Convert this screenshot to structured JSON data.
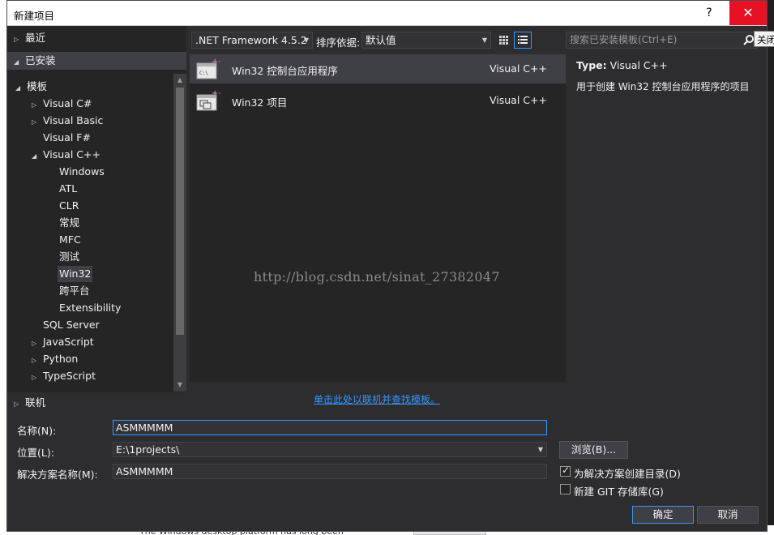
{
  "window": {
    "title": "新建项目",
    "help_label": "?",
    "close_label": "✕",
    "tooltip": "关闭"
  },
  "tree": {
    "recent": "最近",
    "installed": "已安装",
    "templates": "模板",
    "items": [
      {
        "label": "Visual C#"
      },
      {
        "label": "Visual Basic"
      },
      {
        "label": "Visual F#"
      },
      {
        "label": "Visual C++"
      },
      {
        "label": "Windows"
      },
      {
        "label": "ATL"
      },
      {
        "label": "CLR"
      },
      {
        "label": "常规"
      },
      {
        "label": "MFC"
      },
      {
        "label": "测试"
      },
      {
        "label": "Win32"
      },
      {
        "label": "跨平台"
      },
      {
        "label": "Extensibility"
      },
      {
        "label": "SQL Server"
      },
      {
        "label": "JavaScript"
      },
      {
        "label": "Python"
      },
      {
        "label": "TypeScript"
      }
    ],
    "online": "联机"
  },
  "toolbar": {
    "framework": ".NET Framework 4.5.2",
    "sort_label": "排序依据:",
    "sort_value": "默认值",
    "search_placeholder": "搜索已安装模板(Ctrl+E)"
  },
  "templates": [
    {
      "name": "Win32 控制台应用程序",
      "lang": "Visual C++",
      "icon": "console-app-icon"
    },
    {
      "name": "Win32 项目",
      "lang": "Visual C++",
      "icon": "win32-project-icon"
    }
  ],
  "watermark": "http://blog.csdn.net/sinat_27382047",
  "detail": {
    "type_label": "Type:",
    "type_value": "Visual C++",
    "description": "用于创建 Win32 控制台应用程序的项目"
  },
  "online_link": "单击此处以联机并查找模板。",
  "form": {
    "name_label": "名称(N):",
    "name_value": "ASMMMMM",
    "location_label": "位置(L):",
    "location_value": "E:\\1projects\\",
    "solution_label": "解决方案名称(M):",
    "solution_value": "ASMMMMM",
    "browse_label": "浏览(B)...",
    "create_dir_label": "为解决方案创建目录(D)",
    "create_dir_checked": true,
    "git_label": "新建 GIT 存储库(G)",
    "git_checked": false,
    "ok_label": "确定",
    "cancel_label": "取消"
  },
  "background_text": "The Windows desktop platform has long been",
  "colors": {
    "accent": "#3399ff",
    "dialog_bg": "#2d2d30",
    "panel_bg": "#252526",
    "selected_bg": "#3f3f46",
    "close_red": "#e81123"
  }
}
